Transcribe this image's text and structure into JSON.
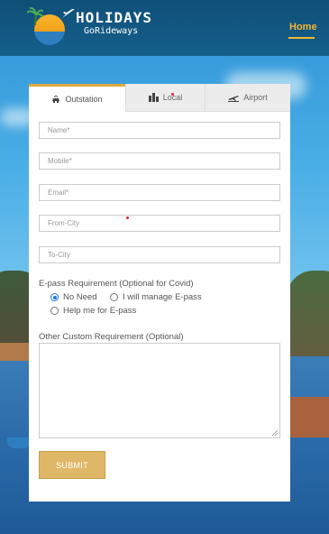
{
  "header": {
    "logo_title": "HOLIDAYS",
    "logo_subtitle": "GoRideways",
    "nav_home": "Home"
  },
  "tabs": [
    {
      "label": "Outstation",
      "icon": "car-icon",
      "active": true
    },
    {
      "label": "Local",
      "icon": "city-icon",
      "active": false
    },
    {
      "label": "Airport",
      "icon": "plane-icon",
      "active": false
    }
  ],
  "form": {
    "name_placeholder": "Name*",
    "mobile_placeholder": "Mobile*",
    "email_placeholder": "Email*",
    "from_city_placeholder": "From-City",
    "to_city_placeholder": "To-City",
    "epass_label": "E-pass Requirement (Optional for Covid)",
    "epass_options": [
      {
        "label": "No Need",
        "checked": true
      },
      {
        "label": "I will manage E-pass",
        "checked": false
      },
      {
        "label": "Help me for E-pass",
        "checked": false
      }
    ],
    "other_label": "Other Custom Requirement (Optional)",
    "other_value": "",
    "submit_label": "SUBMIT"
  },
  "colors": {
    "header_bg": "#155f8c",
    "accent": "#f5b731",
    "submit_bg": "#dfb867",
    "tab_active_border": "#e0a93b"
  }
}
